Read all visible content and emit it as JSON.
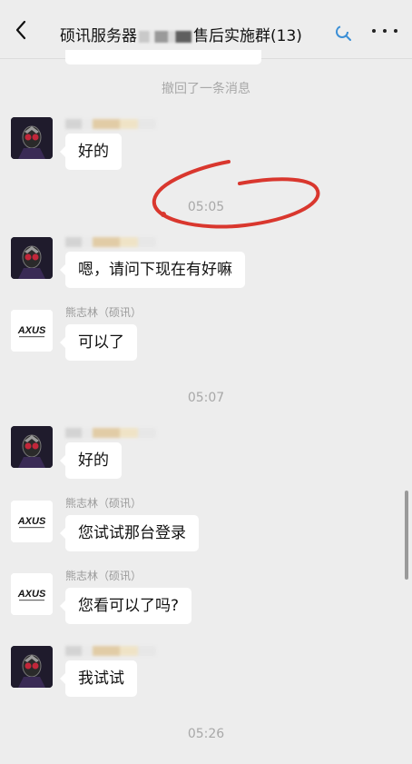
{
  "header": {
    "title_prefix": "硕讯服务器",
    "title_suffix": "售后实施群",
    "member_count": "(13)",
    "back_icon": "chevron-left-icon",
    "more_icon": "more-dots-icon"
  },
  "messages": {
    "recalled_notice": "撤回了一条消息",
    "time_1": "05:05",
    "time_2": "05:07",
    "time_3": "05:26",
    "sender_support": "熊志林（硕讯）",
    "msg_1": "好的",
    "msg_2": "嗯，请问下现在有好嘛",
    "msg_3": "可以了",
    "msg_4": "好的",
    "msg_5": "您试试那台登录",
    "msg_6": "您看可以了吗?",
    "msg_7": "我试试"
  },
  "colors": {
    "background": "#ededed",
    "bubble": "#ffffff",
    "annotation": "#d9372e"
  }
}
